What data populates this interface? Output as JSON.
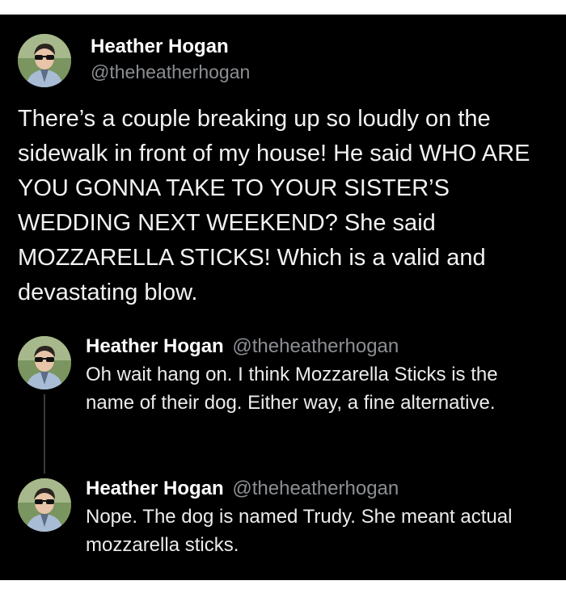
{
  "main_tweet": {
    "author_name": "Heather Hogan",
    "author_handle": "@theheatherhogan",
    "text": "There’s a couple breaking up so loudly on the sidewalk in front of my house! He said WHO ARE YOU GONNA TAKE TO YOUR SISTER’S WEDDING NEXT WEEKEND? She said MOZZARELLA STICKS! Which is a valid and devastating blow."
  },
  "replies": [
    {
      "author_name": "Heather Hogan",
      "author_handle": "@theheatherhogan",
      "text": "Oh wait hang on. I think Mozzarella Sticks is the name of their dog. Either way, a fine alternative."
    },
    {
      "author_name": "Heather Hogan",
      "author_handle": "@theheatherhogan",
      "text": "Nope. The dog is named Trudy. She meant actual mozzarella sticks."
    }
  ],
  "colors": {
    "background": "#000000",
    "text": "#e7e9ea",
    "handle": "#8b8f93"
  }
}
